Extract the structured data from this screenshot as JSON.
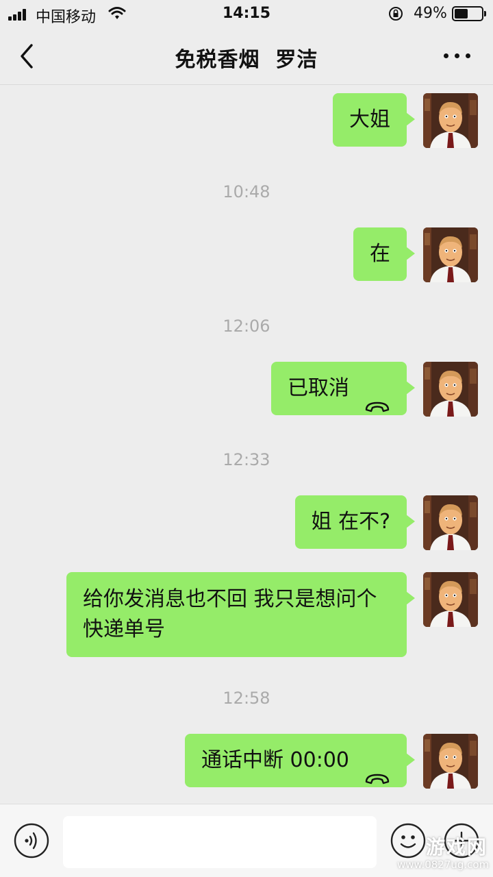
{
  "status_bar": {
    "carrier": "中国移动",
    "time": "14:15",
    "battery_percent": "49%",
    "battery_level": 0.49,
    "icons": [
      "signal-icon",
      "wifi-icon",
      "rotation-lock-icon",
      "battery-icon"
    ]
  },
  "nav": {
    "title": "免税香烟  罗洁",
    "icons": [
      "back-arrow-icon",
      "more-icon"
    ]
  },
  "messages": [
    {
      "type": "text",
      "sender": "self",
      "text": "大姐"
    },
    {
      "type": "timestamp",
      "text": "10:48"
    },
    {
      "type": "text",
      "sender": "self",
      "text": "在"
    },
    {
      "type": "timestamp",
      "text": "12:06"
    },
    {
      "type": "call",
      "sender": "self",
      "text": "已取消",
      "icon": "phone-hangup-icon"
    },
    {
      "type": "timestamp",
      "text": "12:33"
    },
    {
      "type": "text",
      "sender": "self",
      "text": "姐 在不?"
    },
    {
      "type": "text",
      "sender": "self",
      "text": "给你发消息也不回  我只是想问个快递单号"
    },
    {
      "type": "timestamp",
      "text": "12:58"
    },
    {
      "type": "call",
      "sender": "self",
      "text": "通话中断 00:00",
      "icon": "phone-hangup-icon"
    }
  ],
  "input_bar": {
    "placeholder": "",
    "icons": [
      "voice-icon",
      "emoji-icon",
      "plus-icon"
    ]
  },
  "watermark": {
    "main": "游戏网",
    "url": "www.0827ug.com"
  },
  "colors": {
    "background": "#ededed",
    "bubble_self": "#95ec69",
    "timestamp_text": "#aaaaaa"
  }
}
